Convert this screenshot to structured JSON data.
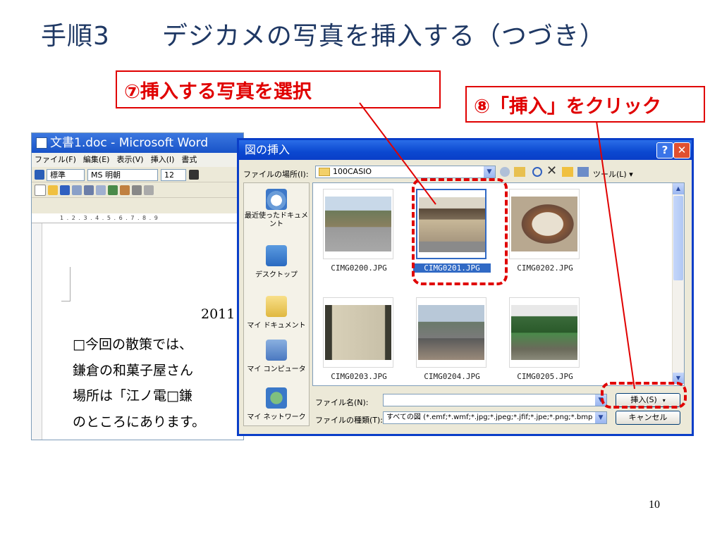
{
  "slide": {
    "title": "手順3　　デジカメの写真を挿入する（つづき）",
    "page_number": "10"
  },
  "callouts": {
    "step7": "⑦挿入する写真を選択",
    "step8": "⑧「挿入」をクリック"
  },
  "word": {
    "title": "文書1.doc - Microsoft Word",
    "menu": [
      "ファイル(F)",
      "編集(E)",
      "表示(V)",
      "挿入(I)",
      "書式"
    ],
    "style": "標準",
    "font": "MS 明朝",
    "size": "12",
    "ruler_numbers": "1 . 2 . 3 . 4 . 5 . 6 . 7 . 8 . 9",
    "doc_lines": [
      "2011",
      "□今回の散策では、",
      "鎌倉の和菓子屋さん",
      "場所は「江ノ電□鎌",
      "のところにあります。"
    ]
  },
  "dialog": {
    "title": "図の挿入",
    "help_label": "?",
    "close_label": "✕",
    "location_label": "ファイルの場所(I):",
    "location_value": "100CASIO",
    "tools_label": "ツール(L) ▾",
    "places": [
      "最近使ったドキュメント",
      "デスクトップ",
      "マイ ドキュメント",
      "マイ コンピュータ",
      "マイ ネットワーク"
    ],
    "files": [
      "CIMG0200.JPG",
      "CIMG0201.JPG",
      "CIMG0202.JPG",
      "CIMG0203.JPG",
      "CIMG0204.JPG",
      "CIMG0205.JPG"
    ],
    "selected_file": "CIMG0201.JPG",
    "filename_label": "ファイル名(N):",
    "filename_value": "",
    "filetype_label": "ファイルの種類(T):",
    "filetype_value": "すべての図 (*.emf;*.wmf;*.jpg;*.jpeg;*.jfif;*.jpe;*.png;*.bmp",
    "insert_button": "挿入(S)",
    "cancel_button": "キャンセル"
  },
  "colors": {
    "accent_red": "#e00000",
    "title_navy": "#1f3864",
    "xp_blue": "#0a3ec8"
  }
}
